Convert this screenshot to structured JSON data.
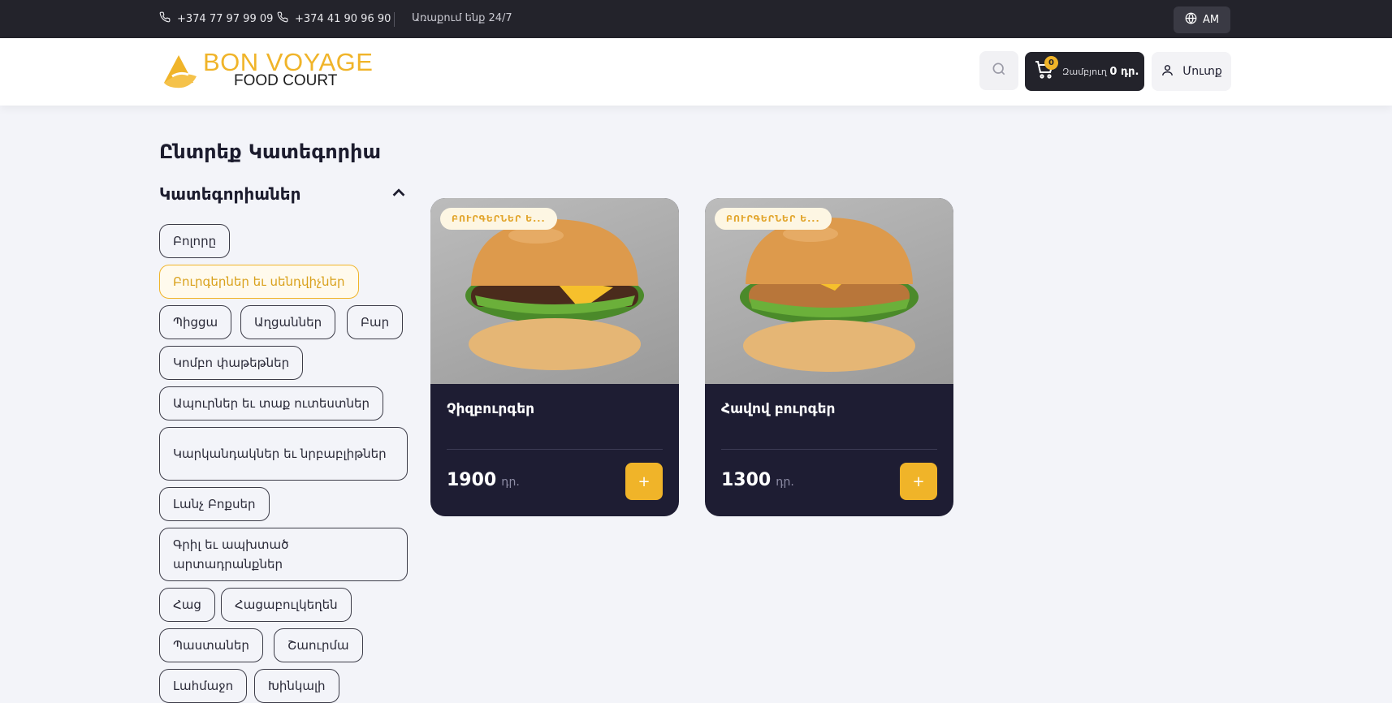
{
  "topbar": {
    "phone1": "+374 77 97 99 09",
    "phone2": "+374 41 90 96 90",
    "open_hours": "Առաքում ենք 24/7",
    "language": "AM"
  },
  "header": {
    "logo_brand": "BON VOYAGE",
    "logo_sub": "FOOD COURT",
    "cart_count": "0",
    "cart_label": "Զամբյուղ",
    "cart_total": "0 դր.",
    "login_label": "Մուտք"
  },
  "sidebar": {
    "page_title": "Ընտրեք Կատեգորիա",
    "categories_title": "Կատեգորիաներ",
    "chips": [
      "Բոլորը",
      "Բուրգերներ եւ սենդվիչներ",
      "Պիցցա",
      "Աղցաններ",
      "Բար",
      "Կոմբո փաթեթներ",
      "Ապուրներ եւ տաք ուտեստներ",
      "Կարկանդակներ եւ նրբաբլիթներ",
      "Լանչ Բոքսեր",
      "Գրիլ եւ ապխտած արտադրանքներ",
      "Հաց",
      "Հացաբուլկեղեն",
      "Պաստաներ",
      "Շաուրմա",
      "Լահմաջո",
      "Խինկալի"
    ],
    "active_chip": "Բուրգերներ եւ սենդվիչներ"
  },
  "products": [
    {
      "tag": "ԲՈՒՐԳԵՐՆԵՐ Ե...",
      "name": "Չիզբուրգեր",
      "price": "1900",
      "currency": "դր.",
      "add_label": "+"
    },
    {
      "tag": "ԲՈՒՐԳԵՐՆԵՐ Ե...",
      "name": "Հավով բուրգեր",
      "price": "1300",
      "currency": "դր.",
      "add_label": "+"
    }
  ],
  "colors": {
    "accent": "#f0b429",
    "dark": "#23232b",
    "card": "#1e1d33"
  }
}
